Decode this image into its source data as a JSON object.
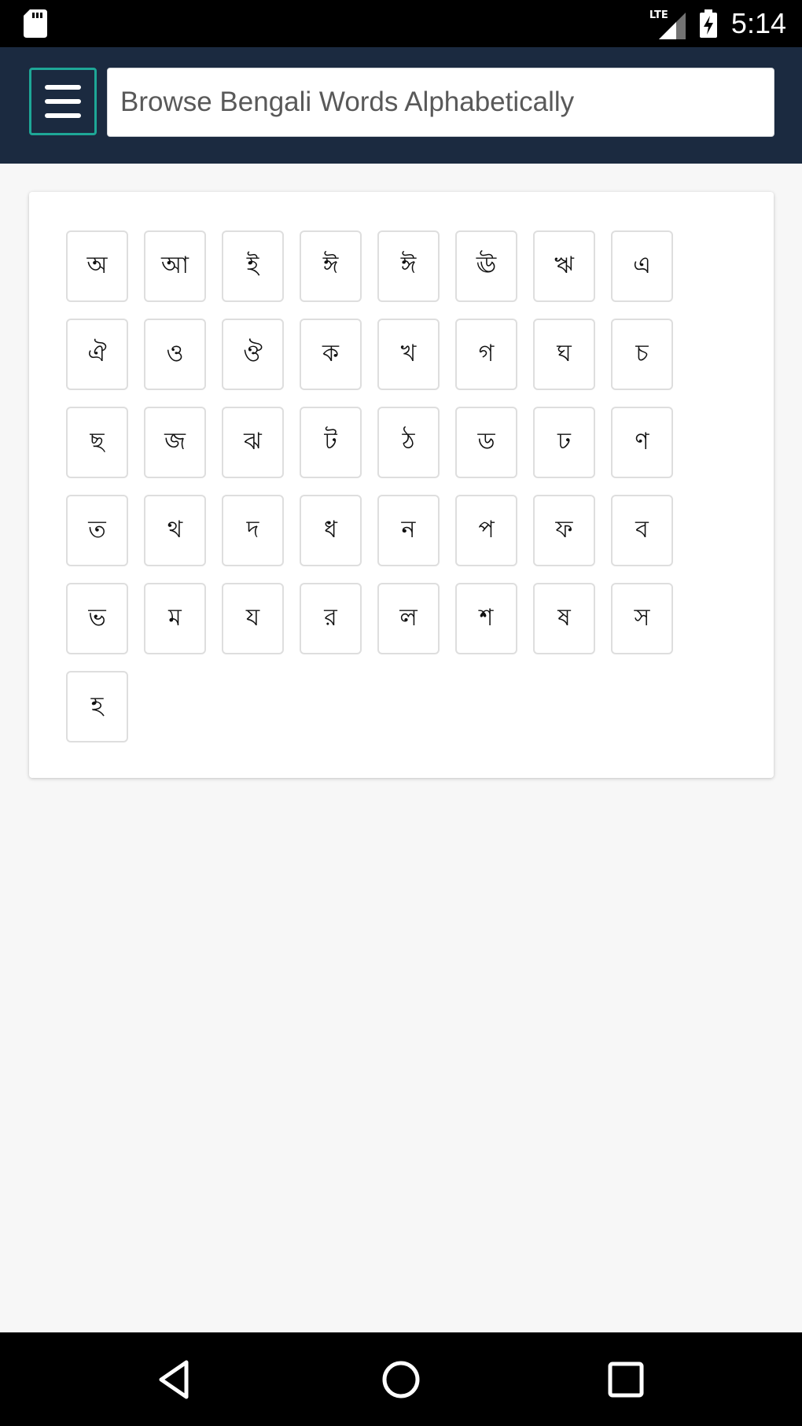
{
  "status_bar": {
    "time": "5:14",
    "network": "LTE",
    "icons": [
      "sd-card-icon",
      "lte-signal-icon",
      "battery-charging-icon"
    ]
  },
  "header": {
    "menu_icon": "hamburger-menu-icon",
    "search": {
      "placeholder": "Browse Bengali Words Alphabetically",
      "value": ""
    }
  },
  "colors": {
    "header_bg": "#1b2a40",
    "menu_border": "#1ea797",
    "page_bg": "#f7f7f7"
  },
  "letters": [
    "অ",
    "আ",
    "ই",
    "ঈ",
    "ঈ",
    "ঊ",
    "ঋ",
    "এ",
    "ঐ",
    "ও",
    "ঔ",
    "ক",
    "খ",
    "গ",
    "ঘ",
    "চ",
    "ছ",
    "জ",
    "ঝ",
    "ট",
    "ঠ",
    "ড",
    "ঢ",
    "ণ",
    "ত",
    "থ",
    "দ",
    "ধ",
    "ন",
    "প",
    "ফ",
    "ব",
    "ভ",
    "ম",
    "য",
    "র",
    "ল",
    "শ",
    "ষ",
    "স",
    "হ"
  ],
  "nav_bar": {
    "icons": [
      "back-icon",
      "home-icon",
      "recent-apps-icon"
    ]
  }
}
